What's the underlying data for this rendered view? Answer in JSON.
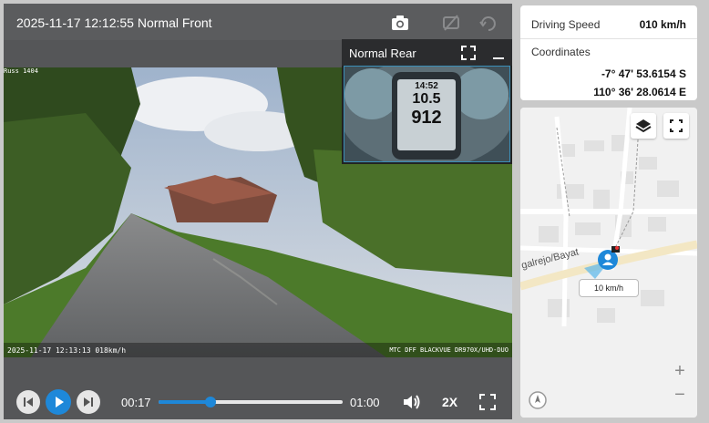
{
  "player": {
    "front_title": "2025-11-17 12:12:55 Normal Front",
    "rear_title": "Normal Rear",
    "overlay_top_left": "Russ 1404",
    "overlay_timestamp": "2025-11-17 12:13:13 018km/h",
    "overlay_device": "MTC DFF BLACKVUE DR970X/UHD-DUO",
    "rear_display": {
      "line1": "14:52",
      "line2": "10.5",
      "line3": "912"
    },
    "current_time": "00:17",
    "total_time": "01:00",
    "progress": 0.28,
    "speed_label": "2X"
  },
  "info": {
    "driving_speed_label": "Driving Speed",
    "driving_speed_value": "010 km/h",
    "coordinates_label": "Coordinates",
    "latitude": "-7° 47' 53.6154 S",
    "longitude": "110° 36' 28.0614 E"
  },
  "map": {
    "road_label": "galrejo/Bayat",
    "marker_speed": "10 km/h",
    "zoom_in": "+",
    "zoom_out": "−"
  },
  "colors": {
    "accent": "#1e88d9",
    "panel": "#555658"
  }
}
